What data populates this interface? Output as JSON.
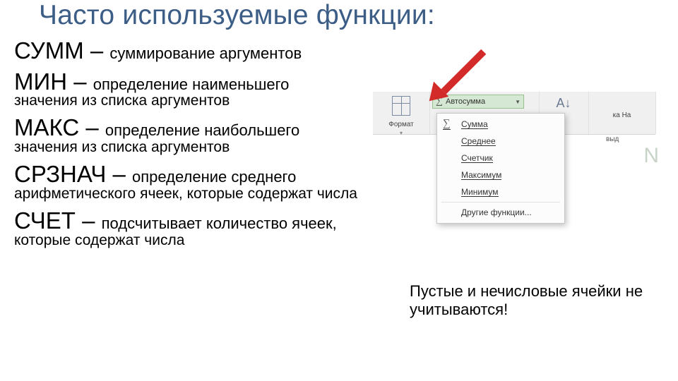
{
  "title": "Часто используемые функции:",
  "funcs": {
    "sum": {
      "name": "СУММ",
      "dash": " – ",
      "desc": "суммирование аргументов"
    },
    "min": {
      "name": "МИН",
      "dash": " – ",
      "desc": "определение наименьшего",
      "cont": "значения из списка аргументов"
    },
    "max": {
      "name": "МАКС",
      "dash": " – ",
      "desc": "определение наибольшего",
      "cont": "значения из списка аргументов"
    },
    "avg": {
      "name": "СРЗНАЧ",
      "dash": " – ",
      "desc": "определение среднего",
      "cont": "арифметического ячеек, которые содержат числа"
    },
    "count": {
      "name": "СЧЕТ",
      "dash": " – ",
      "desc": "подсчитывает количество ячеек,",
      "cont": "которые содержат числа"
    }
  },
  "note": "Пустые и нечисловые ячейки не учитываются!",
  "ribbon": {
    "format": "Формат",
    "autosum": "Автосумма",
    "sort_glyph": "А↓",
    "last_label": "ка   На",
    "below": "выд"
  },
  "menu": {
    "items": [
      "Сумма",
      "Среднее",
      "Счетчик",
      "Максимум",
      "Минимум"
    ],
    "more": "Другие функции..."
  },
  "cell_n": "N"
}
